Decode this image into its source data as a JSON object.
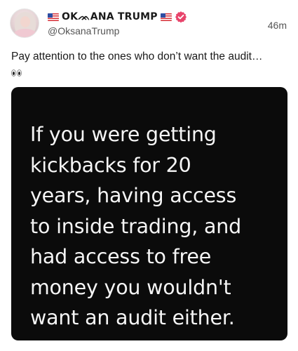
{
  "post": {
    "author": {
      "display_name": "OKᨏANA TRUMP",
      "handle": "@OksanaTrump",
      "avatar_icon": "profile-avatar",
      "flag_icon": "us-flag-icon",
      "verified_icon": "verified-badge-icon",
      "verified_color": "#e8446b"
    },
    "timestamp": "46m",
    "text": "Pay attention to the ones who don’t want the audit…",
    "emoji": "eyes-emoji",
    "media": {
      "background_color": "#0b0b0b",
      "text": "If you were getting\nkickbacks for 20\nyears, having access\nto inside trading, and\nhad access to free\nmoney you wouldn't\nwant an audit either."
    }
  }
}
